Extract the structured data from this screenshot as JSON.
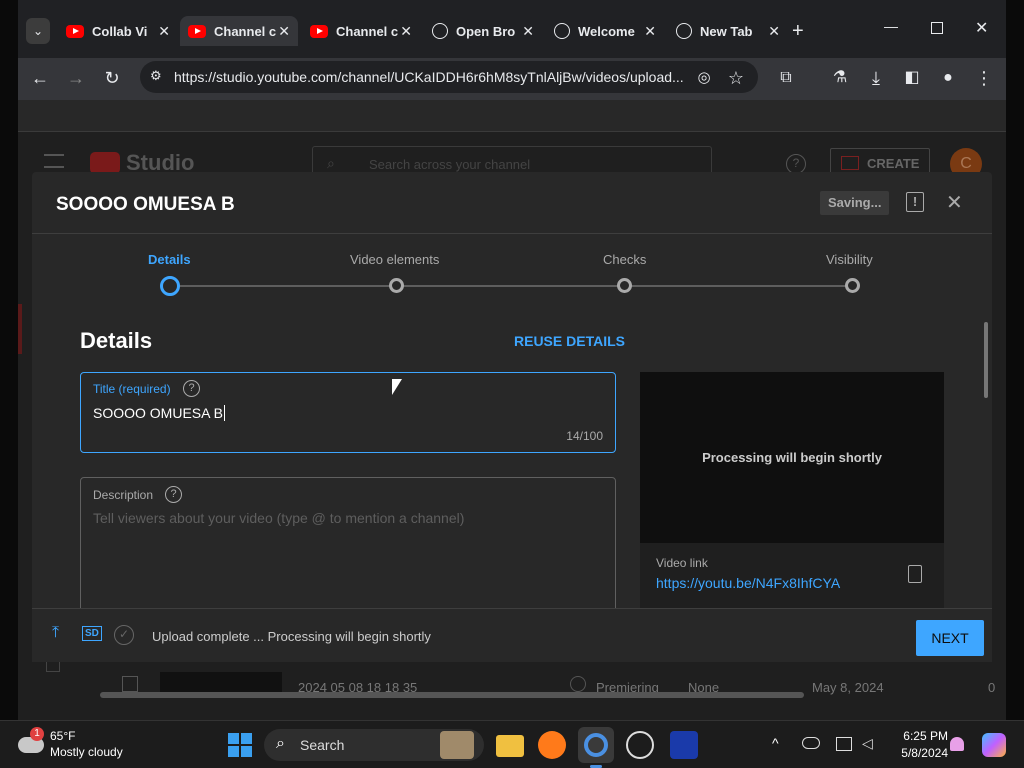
{
  "browser": {
    "tabs": [
      {
        "title": "Collab Vi",
        "icon": "youtube-icon",
        "active": false
      },
      {
        "title": "Channel c",
        "icon": "youtube-icon",
        "active": true
      },
      {
        "title": "Channel c",
        "icon": "youtube-icon",
        "active": false
      },
      {
        "title": "Open Bro",
        "icon": "browser-icon",
        "active": false
      },
      {
        "title": "Welcome",
        "icon": "globe-icon",
        "active": false
      },
      {
        "title": "New Tab",
        "icon": "globe-icon",
        "active": false
      }
    ],
    "url": "https://studio.youtube.com/channel/UCKaIDDH6r6hM8syTnlAljBw/videos/upload..."
  },
  "studio": {
    "logo_text": "Studio",
    "search_placeholder": "Search across your channel",
    "create_label": "CREATE",
    "avatar_letter": "C"
  },
  "dialog": {
    "title": "SOOOO OMUESA B",
    "saving_label": "Saving...",
    "steps": [
      "Details",
      "Video elements",
      "Checks",
      "Visibility"
    ],
    "section_title": "Details",
    "reuse_label": "REUSE DETAILS",
    "title_field": {
      "label": "Title (required)",
      "value": "SOOOO OMUESA B",
      "counter": "14/100"
    },
    "description_field": {
      "label": "Description",
      "placeholder": "Tell viewers about your video (type @ to mention a channel)"
    },
    "preview": {
      "processing_text": "Processing will begin shortly",
      "video_link_label": "Video link",
      "video_link": "https://youtu.be/N4Fx8IhfCYA"
    },
    "footer": {
      "sd_badge": "SD",
      "status": "Upload complete ... Processing will begin shortly",
      "next_label": "NEXT"
    }
  },
  "background_row": {
    "name": "2024 05 08 18 18 35",
    "status": "Premiering",
    "restriction": "None",
    "date": "May 8, 2024",
    "count": "0"
  },
  "taskbar": {
    "weather_badge": "1",
    "temp": "65°F",
    "weather": "Mostly cloudy",
    "search_label": "Search",
    "time": "6:25 PM",
    "date": "5/8/2024"
  },
  "colors": {
    "accent_blue": "#3ea6ff",
    "next_button": "#3ea6ff",
    "dialog_bg": "#282828"
  }
}
